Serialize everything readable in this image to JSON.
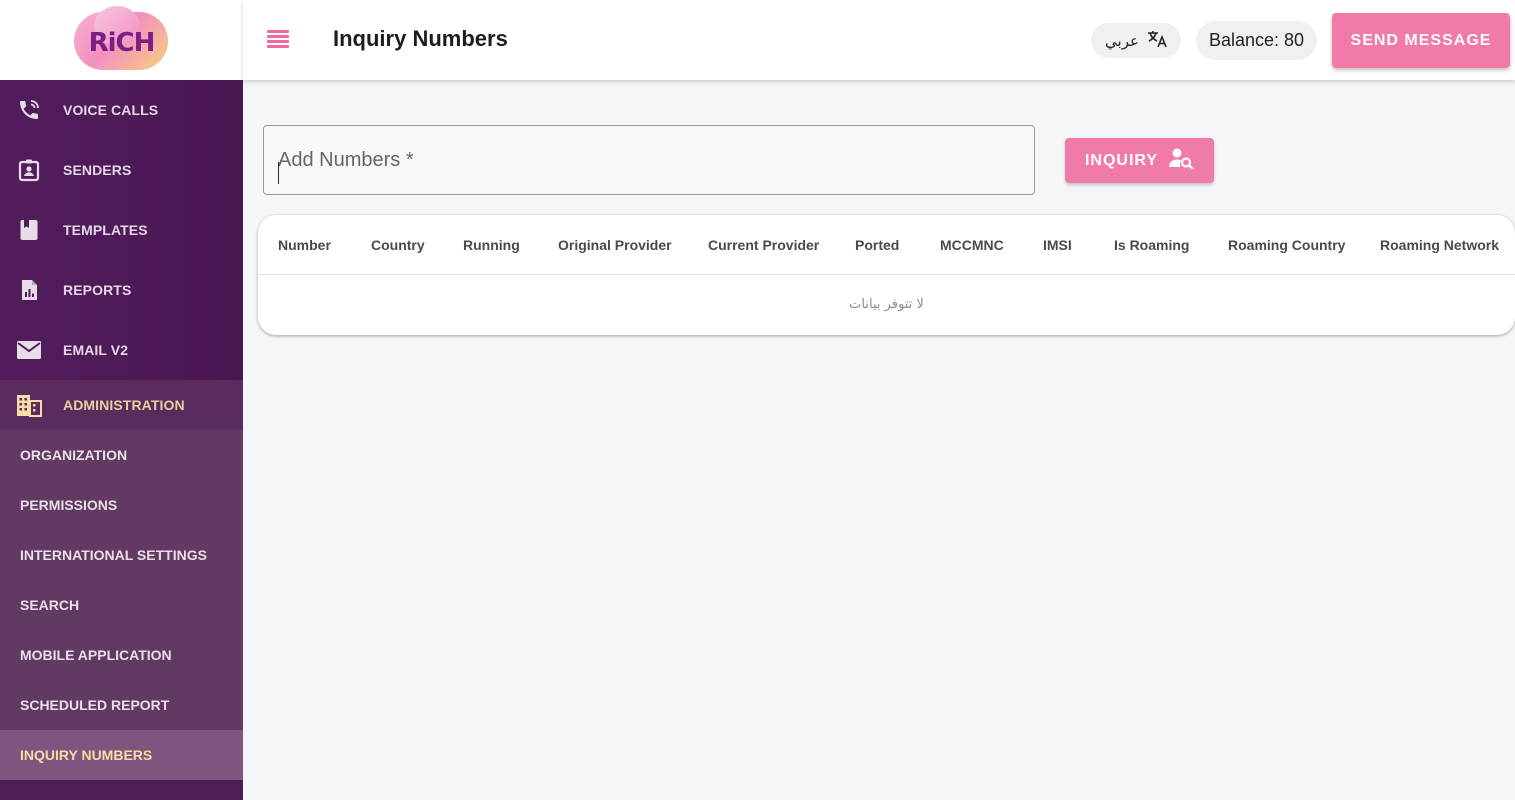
{
  "brand": {
    "logo_text": "RiCH"
  },
  "sidebar": {
    "items": [
      {
        "label": "VOICE CALLS",
        "icon": "phone-icon"
      },
      {
        "label": "SENDERS",
        "icon": "id-badge-icon"
      },
      {
        "label": "TEMPLATES",
        "icon": "bookmark-icon"
      },
      {
        "label": "REPORTS",
        "icon": "report-chart-icon"
      },
      {
        "label": "EMAIL V2",
        "icon": "mail-icon"
      }
    ],
    "admin": {
      "label": "ADMINISTRATION",
      "icon": "building-icon",
      "subitems": [
        {
          "label": "ORGANIZATION"
        },
        {
          "label": "PERMISSIONS"
        },
        {
          "label": "INTERNATIONAL SETTINGS"
        },
        {
          "label": "SEARCH"
        },
        {
          "label": "MOBILE APPLICATION"
        },
        {
          "label": "SCHEDULED REPORT"
        },
        {
          "label": "INQUIRY NUMBERS"
        }
      ]
    }
  },
  "header": {
    "title": "Inquiry Numbers",
    "lang_label": "عربي",
    "balance": "Balance: 80",
    "send_label": "SEND MESSAGE"
  },
  "main": {
    "input_placeholder": "Add Numbers *",
    "inquiry_label": "INQUIRY",
    "table": {
      "columns": [
        "Number",
        "Country",
        "Running",
        "Original Provider",
        "Current Provider",
        "Ported",
        "MCCMNC",
        "IMSI",
        "Is Roaming",
        "Roaming Country",
        "Roaming Network"
      ],
      "empty_text": "لا تتوفر بيانات"
    }
  },
  "colors": {
    "accent": "#f07aa8",
    "sidebar": "#4e1d55",
    "active_text": "#f7dda4"
  }
}
